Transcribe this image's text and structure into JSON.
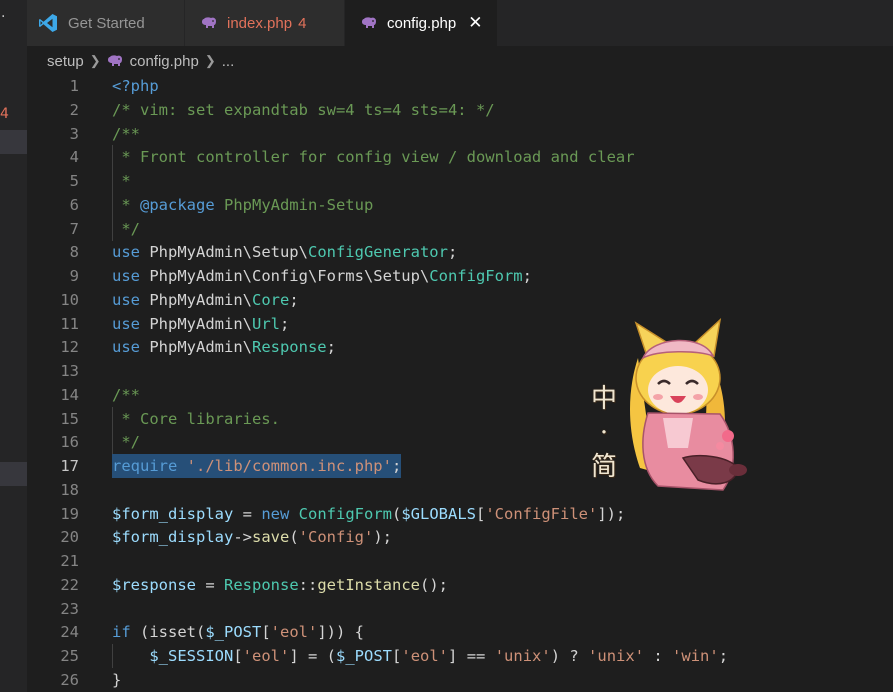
{
  "sidebar": {
    "error_badge": "4"
  },
  "tabs": [
    {
      "label": "Get Started",
      "state": "inactive",
      "icon": "vscode-icon"
    },
    {
      "label": "index.php",
      "errors": "4",
      "state": "inactive",
      "icon": "php-elephant-icon"
    },
    {
      "label": "config.php",
      "state": "active",
      "icon": "php-elephant-icon",
      "close_icon": "✕"
    }
  ],
  "breadcrumb": {
    "folder": "setup",
    "file": "config.php",
    "more": "..."
  },
  "editor": {
    "active_line": 17,
    "lines": [
      {
        "n": "1",
        "tokens": [
          [
            "k",
            "<?php"
          ]
        ]
      },
      {
        "n": "2",
        "tokens": [
          [
            "c",
            "/* vim: set expandtab sw=4 ts=4 sts=4: */"
          ]
        ]
      },
      {
        "n": "3",
        "tokens": [
          [
            "c",
            "/**"
          ]
        ]
      },
      {
        "n": "4",
        "tokens": [
          [
            "c",
            " * Front controller for config view / download and clear"
          ]
        ],
        "guide": true
      },
      {
        "n": "5",
        "tokens": [
          [
            "c",
            " *"
          ]
        ],
        "guide": true
      },
      {
        "n": "6",
        "tokens": [
          [
            "c",
            " * "
          ],
          [
            "d",
            "@package"
          ],
          [
            "c",
            " PhpMyAdmin-Setup"
          ]
        ],
        "guide": true
      },
      {
        "n": "7",
        "tokens": [
          [
            "c",
            " */"
          ]
        ],
        "guide": true
      },
      {
        "n": "8",
        "tokens": [
          [
            "k",
            "use"
          ],
          [
            "p",
            " PhpMyAdmin\\Setup\\"
          ],
          [
            "t",
            "ConfigGenerator"
          ],
          [
            "p",
            ";"
          ]
        ]
      },
      {
        "n": "9",
        "tokens": [
          [
            "k",
            "use"
          ],
          [
            "p",
            " PhpMyAdmin\\Config\\Forms\\Setup\\"
          ],
          [
            "t",
            "ConfigForm"
          ],
          [
            "p",
            ";"
          ]
        ]
      },
      {
        "n": "10",
        "tokens": [
          [
            "k",
            "use"
          ],
          [
            "p",
            " PhpMyAdmin\\"
          ],
          [
            "t",
            "Core"
          ],
          [
            "p",
            ";"
          ]
        ]
      },
      {
        "n": "11",
        "tokens": [
          [
            "k",
            "use"
          ],
          [
            "p",
            " PhpMyAdmin\\"
          ],
          [
            "t",
            "Url"
          ],
          [
            "p",
            ";"
          ]
        ]
      },
      {
        "n": "12",
        "tokens": [
          [
            "k",
            "use"
          ],
          [
            "p",
            " PhpMyAdmin\\"
          ],
          [
            "t",
            "Response"
          ],
          [
            "p",
            ";"
          ]
        ]
      },
      {
        "n": "13",
        "tokens": []
      },
      {
        "n": "14",
        "tokens": [
          [
            "c",
            "/**"
          ]
        ]
      },
      {
        "n": "15",
        "tokens": [
          [
            "c",
            " * Core libraries."
          ]
        ],
        "guide": true
      },
      {
        "n": "16",
        "tokens": [
          [
            "c",
            " */"
          ]
        ],
        "guide": true
      },
      {
        "n": "17",
        "tokens": [
          [
            "k",
            "require"
          ],
          [
            "p",
            " "
          ],
          [
            "s",
            "'./lib/common.inc.php'"
          ],
          [
            "p",
            ";"
          ]
        ],
        "highlight": true
      },
      {
        "n": "18",
        "tokens": []
      },
      {
        "n": "19",
        "tokens": [
          [
            "v",
            "$form_display"
          ],
          [
            "p",
            " = "
          ],
          [
            "k",
            "new"
          ],
          [
            "p",
            " "
          ],
          [
            "t",
            "ConfigForm"
          ],
          [
            "p",
            "("
          ],
          [
            "v",
            "$GLOBALS"
          ],
          [
            "p",
            "["
          ],
          [
            "s",
            "'ConfigFile'"
          ],
          [
            "p",
            "]);"
          ]
        ]
      },
      {
        "n": "20",
        "tokens": [
          [
            "v",
            "$form_display"
          ],
          [
            "p",
            "->"
          ],
          [
            "f",
            "save"
          ],
          [
            "p",
            "("
          ],
          [
            "s",
            "'Config'"
          ],
          [
            "p",
            ");"
          ]
        ]
      },
      {
        "n": "21",
        "tokens": []
      },
      {
        "n": "22",
        "tokens": [
          [
            "v",
            "$response"
          ],
          [
            "p",
            " = "
          ],
          [
            "t",
            "Response"
          ],
          [
            "p",
            "::"
          ],
          [
            "f",
            "getInstance"
          ],
          [
            "p",
            "();"
          ]
        ]
      },
      {
        "n": "23",
        "tokens": []
      },
      {
        "n": "24",
        "tokens": [
          [
            "k",
            "if"
          ],
          [
            "p",
            " (isset("
          ],
          [
            "v",
            "$_POST"
          ],
          [
            "p",
            "["
          ],
          [
            "s",
            "'eol'"
          ],
          [
            "p",
            "])) {"
          ]
        ]
      },
      {
        "n": "25",
        "tokens": [
          [
            "p",
            "    "
          ],
          [
            "v",
            "$_SESSION"
          ],
          [
            "p",
            "["
          ],
          [
            "s",
            "'eol'"
          ],
          [
            "p",
            "] = ("
          ],
          [
            "v",
            "$_POST"
          ],
          [
            "p",
            "["
          ],
          [
            "s",
            "'eol'"
          ],
          [
            "p",
            "] == "
          ],
          [
            "s",
            "'unix'"
          ],
          [
            "p",
            ") ? "
          ],
          [
            "s",
            "'unix'"
          ],
          [
            "p",
            " : "
          ],
          [
            "s",
            "'win'"
          ],
          [
            "p",
            ";"
          ]
        ],
        "guide": true
      },
      {
        "n": "26",
        "tokens": [
          [
            "p",
            "}"
          ]
        ]
      }
    ]
  },
  "sticker": {
    "icon": "anime-girl-sticker",
    "chars": [
      "中",
      "·",
      "简"
    ]
  },
  "colors": {
    "editor_bg": "#1e1e1e",
    "comment": "#6a9955",
    "keyword": "#569cd6",
    "type": "#4ec9b0",
    "string": "#ce9178",
    "variable": "#9cdcfe",
    "error": "#e2725b",
    "selection": "#264f78"
  }
}
